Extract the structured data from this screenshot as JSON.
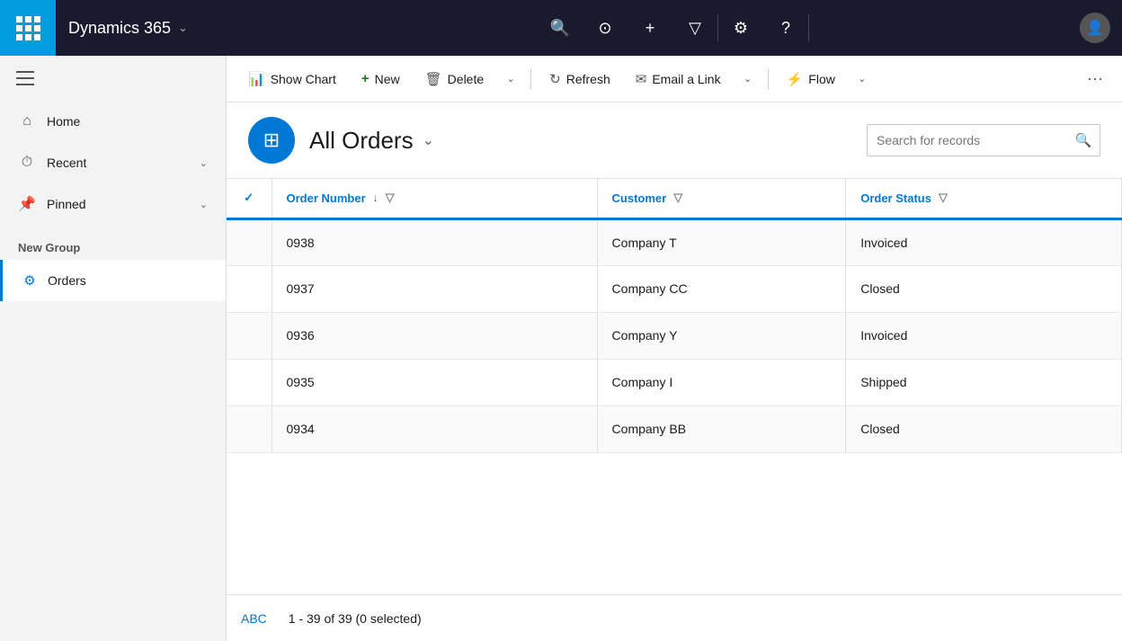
{
  "app": {
    "brand": "Dynamics 365",
    "brand_chevron": "⌄"
  },
  "topnav": {
    "icons": [
      "🔍",
      "⊙",
      "+",
      "▽",
      "⚙",
      "?"
    ]
  },
  "sidebar": {
    "nav_items": [
      {
        "id": "home",
        "icon": "⌂",
        "label": "Home",
        "has_chevron": false
      },
      {
        "id": "recent",
        "icon": "⏱",
        "label": "Recent",
        "has_chevron": true
      },
      {
        "id": "pinned",
        "icon": "📌",
        "label": "Pinned",
        "has_chevron": true
      }
    ],
    "section_label": "New Group",
    "menu_items": [
      {
        "id": "orders",
        "icon": "⚙",
        "label": "Orders",
        "active": true
      }
    ]
  },
  "toolbar": {
    "show_chart_label": "Show Chart",
    "new_label": "New",
    "delete_label": "Delete",
    "refresh_label": "Refresh",
    "email_link_label": "Email a Link",
    "flow_label": "Flow",
    "more_icon": "···"
  },
  "page_header": {
    "title": "All Orders",
    "search_placeholder": "Search for records"
  },
  "table": {
    "columns": [
      {
        "id": "check",
        "label": "✓"
      },
      {
        "id": "order_number",
        "label": "Order Number",
        "sortable": true,
        "filterable": true
      },
      {
        "id": "customer",
        "label": "Customer",
        "filterable": true
      },
      {
        "id": "order_status",
        "label": "Order Status",
        "filterable": true
      }
    ],
    "rows": [
      {
        "order_number": "0938",
        "customer": "Company T",
        "order_status": "Invoiced"
      },
      {
        "order_number": "0937",
        "customer": "Company CC",
        "order_status": "Closed"
      },
      {
        "order_number": "0936",
        "customer": "Company Y",
        "order_status": "Invoiced"
      },
      {
        "order_number": "0935",
        "customer": "Company I",
        "order_status": "Shipped"
      },
      {
        "order_number": "0934",
        "customer": "Company BB",
        "order_status": "Closed"
      }
    ]
  },
  "footer": {
    "abc_label": "ABC",
    "pagination_label": "1 - 39 of 39 (0 selected)"
  }
}
